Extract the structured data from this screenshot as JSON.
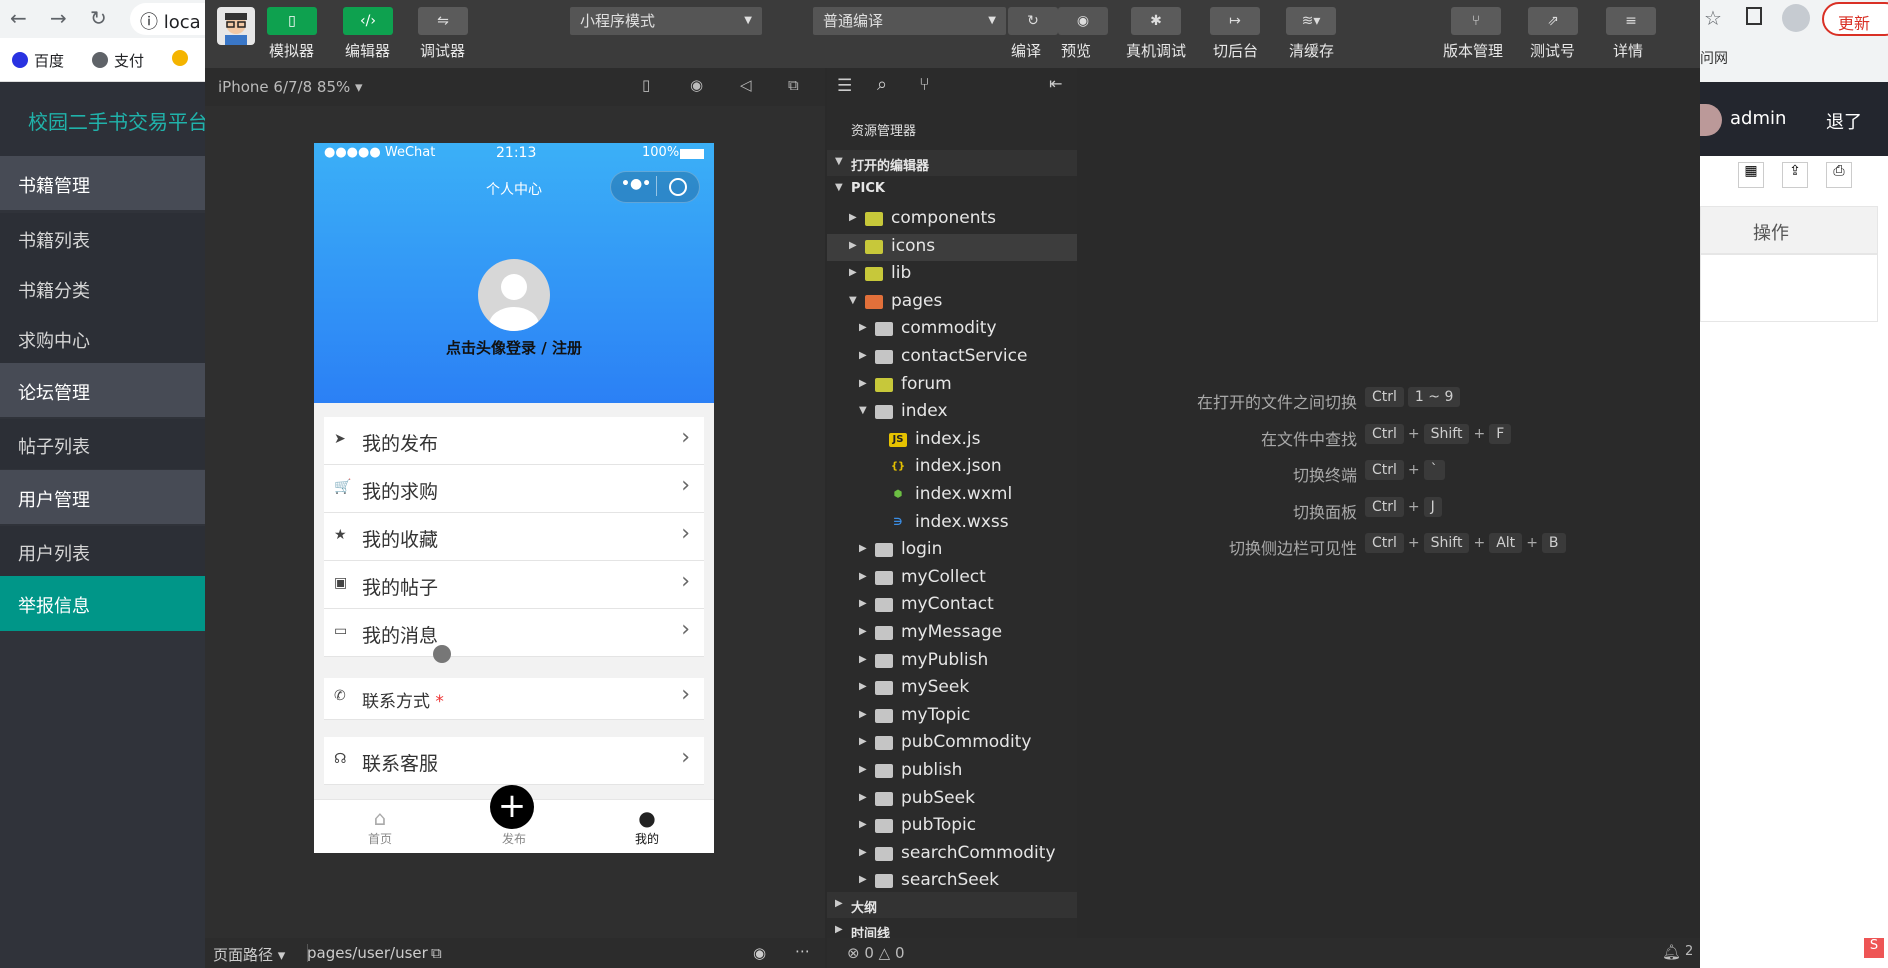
{
  "browser": {
    "url_fragment": "loca",
    "bookmarks": [
      "百度",
      "支付"
    ],
    "update_label": "更新",
    "right_fragment": "问网"
  },
  "admin": {
    "brand": "校园二手书交易平台",
    "user": "admin",
    "logout": "退了",
    "column_header": "操作",
    "menu": [
      {
        "label": "书籍管理",
        "type": "group"
      },
      {
        "label": "书籍列表",
        "type": "item"
      },
      {
        "label": "书籍分类",
        "type": "item"
      },
      {
        "label": "求购中心",
        "type": "item"
      },
      {
        "label": "论坛管理",
        "type": "group"
      },
      {
        "label": "帖子列表",
        "type": "item"
      },
      {
        "label": "用户管理",
        "type": "group"
      },
      {
        "label": "用户列表",
        "type": "item"
      },
      {
        "label": "举报信息",
        "type": "active"
      }
    ]
  },
  "toolbar": {
    "simulator": "模拟器",
    "editor": "编辑器",
    "debugger": "调试器",
    "mode": "小程序模式",
    "compile_mode": "普通编译",
    "compile": "编译",
    "preview": "预览",
    "real_debug": "真机调试",
    "backend": "切后台",
    "clear_cache": "清缓存",
    "version": "版本管理",
    "test_id": "测试号",
    "details": "详情"
  },
  "simulator": {
    "device": "iPhone 6/7/8 85%",
    "page_path_label": "页面路径",
    "page_path": "pages/user/user"
  },
  "phone": {
    "carrier": "●●●●● WeChat",
    "time": "21:13",
    "battery": "100%",
    "nav_title": "个人中心",
    "login_prompt": "点击头像登录 / 注册",
    "menu": [
      {
        "icon": "send-icon",
        "label": "我的发布"
      },
      {
        "icon": "cart-icon",
        "label": "我的求购"
      },
      {
        "icon": "star-icon",
        "label": "我的收藏"
      },
      {
        "icon": "post-icon",
        "label": "我的帖子"
      },
      {
        "icon": "message-icon",
        "label": "我的消息"
      }
    ],
    "contact_label": "联系方式",
    "required_mark": "*",
    "service_label": "联系客服",
    "tabs": [
      "首页",
      "发布",
      "我的"
    ]
  },
  "explorer": {
    "title": "资源管理器",
    "open_editors": "打开的编辑器",
    "project": "PICK",
    "outline": "大纲",
    "timeline": "时间线",
    "tree": [
      {
        "name": "components",
        "depth": 1,
        "kind": "folder-special",
        "open": false
      },
      {
        "name": "icons",
        "depth": 1,
        "kind": "folder-special",
        "open": false,
        "selected": true
      },
      {
        "name": "lib",
        "depth": 1,
        "kind": "folder-special",
        "open": false
      },
      {
        "name": "pages",
        "depth": 1,
        "kind": "folder-pages",
        "open": true
      },
      {
        "name": "commodity",
        "depth": 2,
        "kind": "folder",
        "open": false
      },
      {
        "name": "contactService",
        "depth": 2,
        "kind": "folder",
        "open": false
      },
      {
        "name": "forum",
        "depth": 2,
        "kind": "folder-special",
        "open": false
      },
      {
        "name": "index",
        "depth": 2,
        "kind": "folder",
        "open": true
      },
      {
        "name": "index.js",
        "depth": 3,
        "kind": "js"
      },
      {
        "name": "index.json",
        "depth": 3,
        "kind": "json"
      },
      {
        "name": "index.wxml",
        "depth": 3,
        "kind": "wxml"
      },
      {
        "name": "index.wxss",
        "depth": 3,
        "kind": "wxss"
      },
      {
        "name": "login",
        "depth": 2,
        "kind": "folder",
        "open": false
      },
      {
        "name": "myCollect",
        "depth": 2,
        "kind": "folder",
        "open": false
      },
      {
        "name": "myContact",
        "depth": 2,
        "kind": "folder",
        "open": false
      },
      {
        "name": "myMessage",
        "depth": 2,
        "kind": "folder",
        "open": false
      },
      {
        "name": "myPublish",
        "depth": 2,
        "kind": "folder",
        "open": false
      },
      {
        "name": "mySeek",
        "depth": 2,
        "kind": "folder",
        "open": false
      },
      {
        "name": "myTopic",
        "depth": 2,
        "kind": "folder",
        "open": false
      },
      {
        "name": "pubCommodity",
        "depth": 2,
        "kind": "folder",
        "open": false
      },
      {
        "name": "publish",
        "depth": 2,
        "kind": "folder",
        "open": false
      },
      {
        "name": "pubSeek",
        "depth": 2,
        "kind": "folder",
        "open": false
      },
      {
        "name": "pubTopic",
        "depth": 2,
        "kind": "folder",
        "open": false
      },
      {
        "name": "searchCommodity",
        "depth": 2,
        "kind": "folder",
        "open": false
      },
      {
        "name": "searchSeek",
        "depth": 2,
        "kind": "folder",
        "open": false
      }
    ]
  },
  "shortcuts": [
    {
      "label": "在打开的文件之间切换",
      "keys": [
        "Ctrl",
        "1 ~ 9"
      ],
      "joined": false
    },
    {
      "label": "在文件中查找",
      "keys": [
        "Ctrl",
        "Shift",
        "F"
      ],
      "joined": true
    },
    {
      "label": "切换终端",
      "keys": [
        "Ctrl",
        "`"
      ],
      "joined": true
    },
    {
      "label": "切换面板",
      "keys": [
        "Ctrl",
        "J"
      ],
      "joined": true
    },
    {
      "label": "切换侧边栏可见性",
      "keys": [
        "Ctrl",
        "Shift",
        "Alt",
        "B"
      ],
      "joined": true
    }
  ],
  "status": {
    "errors": "0",
    "warnings": "0",
    "notifications": "2"
  }
}
